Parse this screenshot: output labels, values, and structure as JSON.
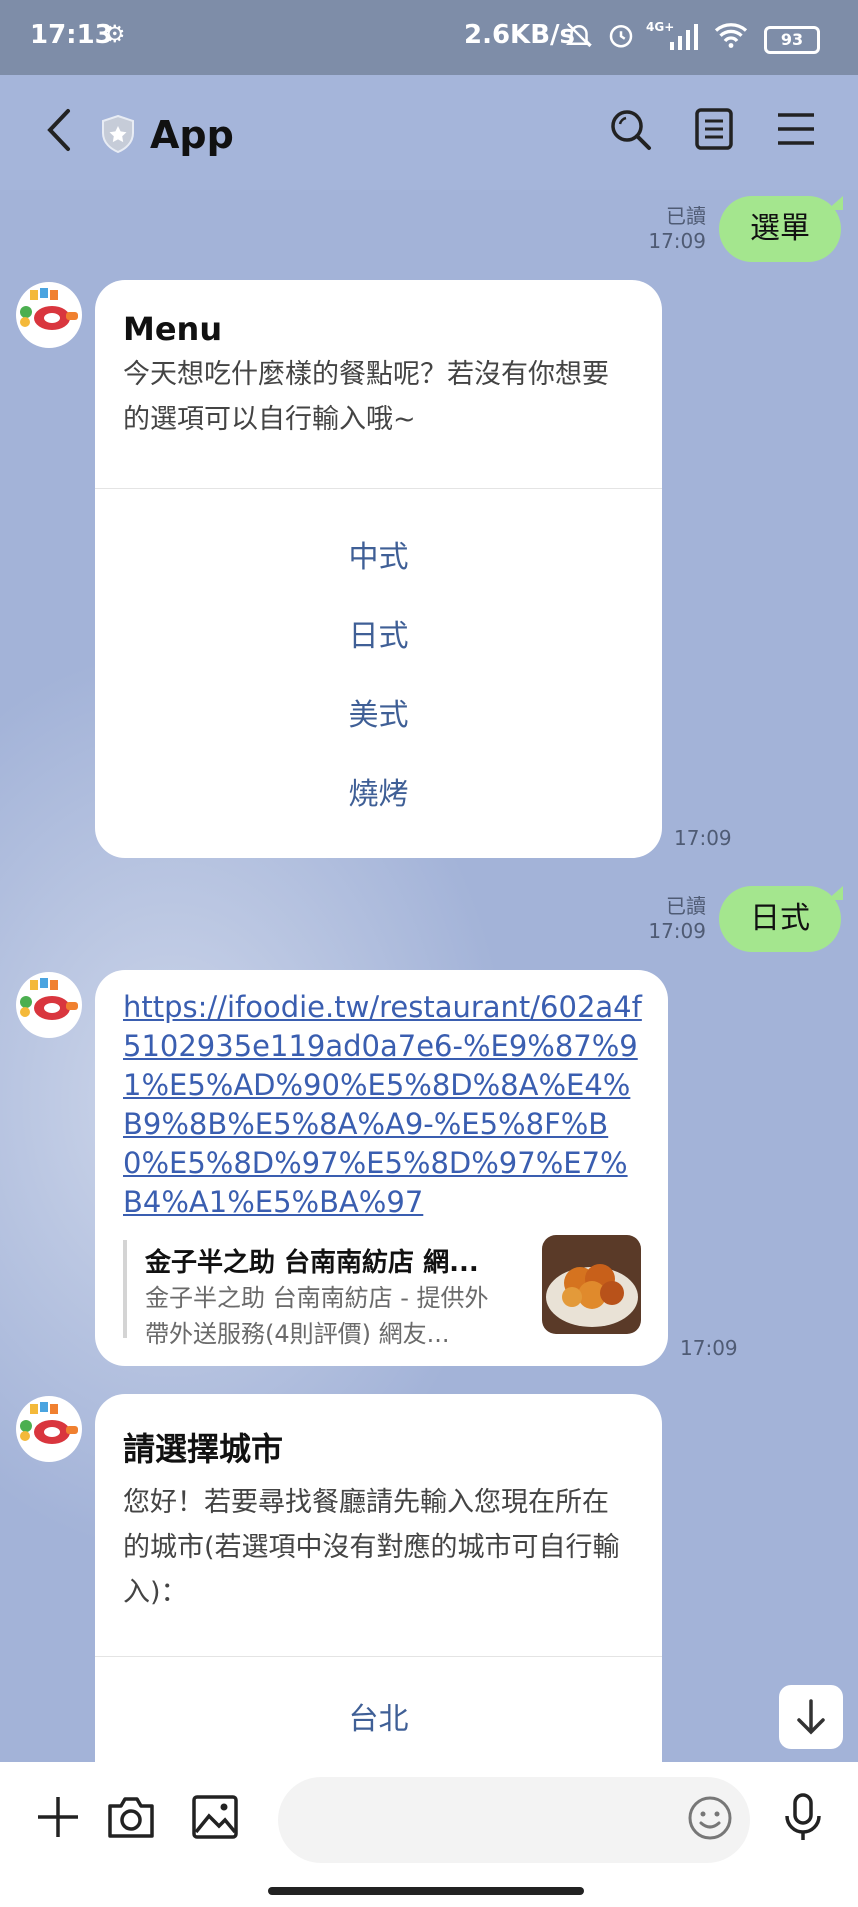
{
  "status_bar": {
    "time": "17:13",
    "net_speed": "2.6KB/s",
    "network_label": "4G+",
    "battery": "93"
  },
  "header": {
    "title": "App"
  },
  "messages": {
    "m1": {
      "text": "選單",
      "read": "已讀",
      "time": "17:09"
    },
    "m2": {
      "title": "Menu",
      "body": "今天想吃什麼樣的餐點呢？若沒有你想要的選項可以自行輸入哦~",
      "options": [
        "中式",
        "日式",
        "美式",
        "燒烤"
      ],
      "time": "17:09"
    },
    "m3": {
      "text": "日式",
      "read": "已讀",
      "time": "17:09"
    },
    "m4": {
      "link": "https://ifoodie.tw/restaurant/602a4f5102935e119ad0a7e6-%E9%87%91%E5%AD%90%E5%8D%8A%E4%B9%8B%E5%8A%A9-%E5%8F%B0%E5%8D%97%E5%8D%97%E7%B4%A1%E5%BA%97",
      "preview_title": "金子半之助 台南南紡店 網...",
      "preview_desc": "金子半之助 台南南紡店 - 提供外帶外送服務(4則評價) 網友...",
      "time": "17:09"
    },
    "m5": {
      "title": "請選擇城市",
      "body": "您好！若要尋找餐廳請先輸入您現在所在的城市(若選項中沒有對應的城市可自行輸入)：",
      "options": [
        "台北"
      ]
    }
  },
  "input": {
    "placeholder": ""
  },
  "colors": {
    "accent": "#a4e68e",
    "link": "#3a5eb0",
    "option": "#3f5f96",
    "chat_bg": "#a3b3d8"
  },
  "icons": [
    "back-icon",
    "shield-icon",
    "search-icon",
    "notes-icon",
    "menu-icon",
    "plus-icon",
    "camera-icon",
    "image-icon",
    "emoji-icon",
    "mic-icon",
    "arrow-down-icon",
    "settings-icon"
  ]
}
